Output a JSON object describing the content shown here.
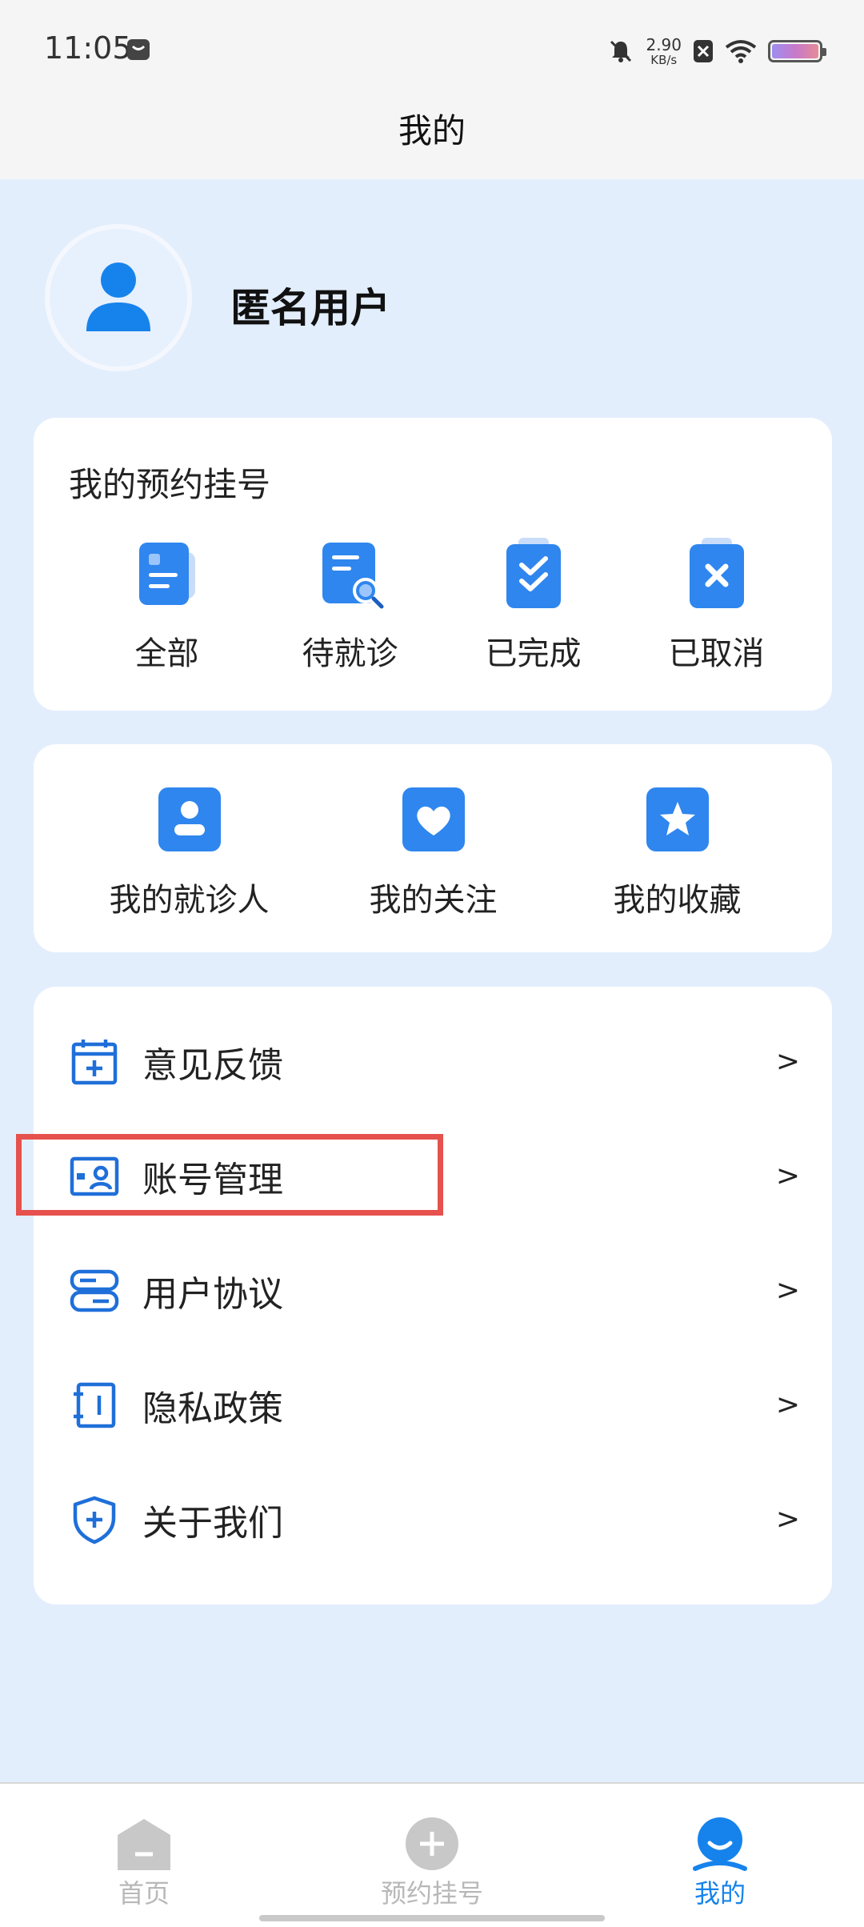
{
  "status_bar": {
    "time": "11:05",
    "speed_value": "2.90",
    "speed_unit": "KB/s"
  },
  "header": {
    "title": "我的"
  },
  "profile": {
    "username": "匿名用户"
  },
  "appointments": {
    "title": "我的预约挂号",
    "items": [
      {
        "label": "全部",
        "icon": "all-doc-icon"
      },
      {
        "label": "待就诊",
        "icon": "pending-search-icon"
      },
      {
        "label": "已完成",
        "icon": "completed-check-icon"
      },
      {
        "label": "已取消",
        "icon": "cancelled-x-icon"
      }
    ]
  },
  "quick_links": {
    "items": [
      {
        "label": "我的就诊人",
        "icon": "patient-icon"
      },
      {
        "label": "我的关注",
        "icon": "heart-icon"
      },
      {
        "label": "我的收藏",
        "icon": "star-icon"
      }
    ]
  },
  "menu": {
    "arrow": ">",
    "items": [
      {
        "label": "意见反馈",
        "icon": "calendar-plus-icon"
      },
      {
        "label": "账号管理",
        "icon": "id-card-icon"
      },
      {
        "label": "用户协议",
        "icon": "agreement-icon"
      },
      {
        "label": "隐私政策",
        "icon": "notebook-icon"
      },
      {
        "label": "关于我们",
        "icon": "shield-plus-icon"
      }
    ]
  },
  "tabbar": {
    "items": [
      {
        "label": "首页",
        "active": false
      },
      {
        "label": "预约挂号",
        "active": false
      },
      {
        "label": "我的",
        "active": true
      }
    ]
  },
  "colors": {
    "accent": "#1683ec",
    "highlight": "#e6514d",
    "background": "#e3eefd"
  }
}
